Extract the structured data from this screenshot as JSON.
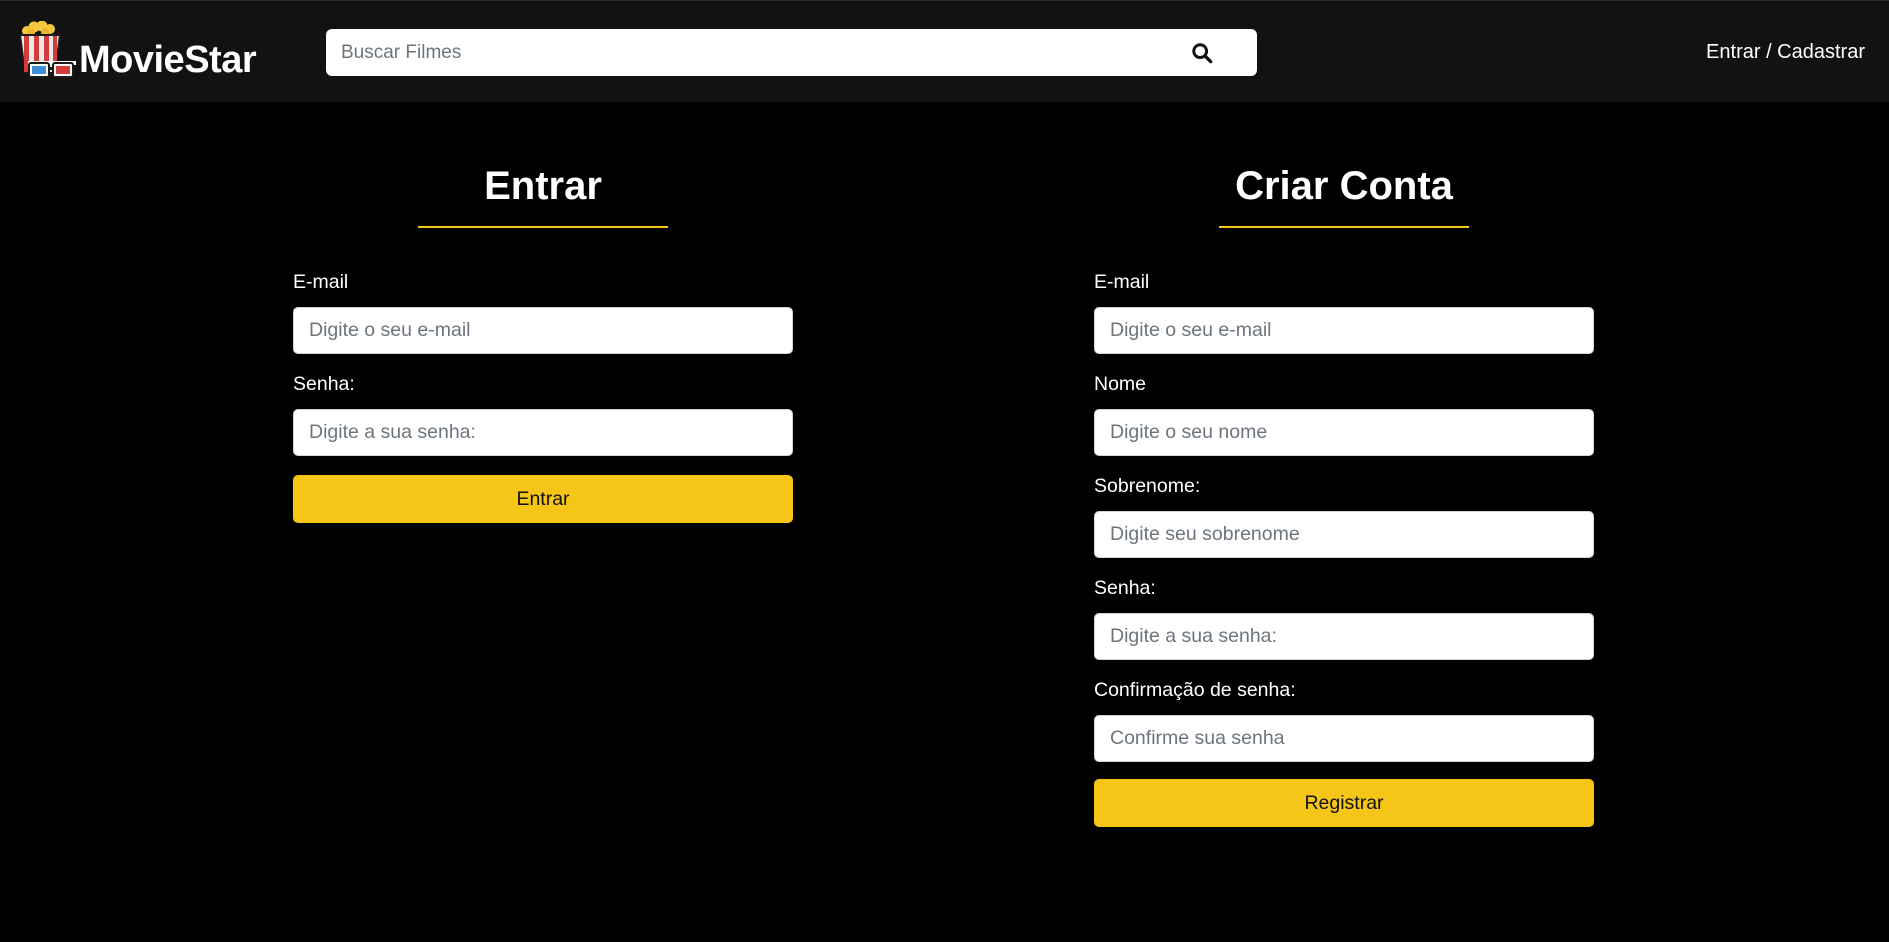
{
  "header": {
    "brand_name": "MovieStar",
    "logo_icon": "popcorn-3d-glasses-icon",
    "search_placeholder": "Buscar Filmes",
    "search_icon": "search-icon",
    "nav_link": "Entrar / Cadastrar"
  },
  "login": {
    "title": "Entrar",
    "email_label": "E-mail",
    "email_placeholder": "Digite o seu e-mail",
    "password_label": "Senha:",
    "password_placeholder": "Digite a sua senha:",
    "submit_label": "Entrar"
  },
  "register": {
    "title": "Criar Conta",
    "email_label": "E-mail",
    "email_placeholder": "Digite o seu e-mail",
    "name_label": "Nome",
    "name_placeholder": "Digite o seu nome",
    "lastname_label": "Sobrenome:",
    "lastname_placeholder": "Digite seu sobrenome",
    "password_label": "Senha:",
    "password_placeholder": "Digite a sua senha:",
    "confirm_label": "Confirmação de senha:",
    "confirm_placeholder": "Confirme sua senha",
    "submit_label": "Registrar"
  },
  "colors": {
    "accent": "#f5c518",
    "navbar_bg": "#121212",
    "page_bg": "#000000"
  }
}
